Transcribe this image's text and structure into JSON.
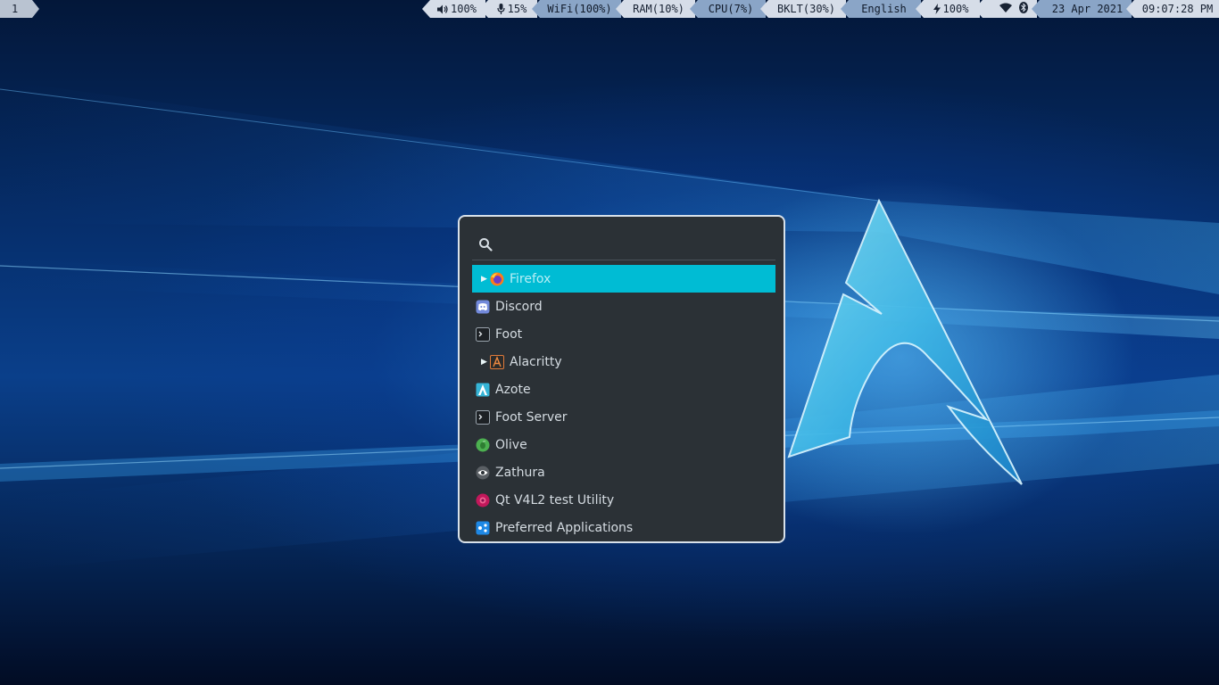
{
  "topbar": {
    "workspace": "1",
    "volume": "100%",
    "mic": "15%",
    "wifi": "WiFi(100%)",
    "ram": "RAM(10%)",
    "cpu": "CPU(7%)",
    "backlight": "BKLT(30%)",
    "language": "English",
    "battery": "100%",
    "date": "23 Apr 2021",
    "time": "09:07:28 PM",
    "icons": [
      "volume-icon",
      "microphone-icon",
      "battery-charging-icon",
      "wifi-icon",
      "bluetooth-icon"
    ]
  },
  "launcher": {
    "search": {
      "value": "",
      "placeholder": ""
    },
    "apps": [
      {
        "label": "Firefox",
        "icon": "firefox-icon",
        "selected": true,
        "expandable": true
      },
      {
        "label": "Discord",
        "icon": "discord-icon",
        "selected": false,
        "expandable": false
      },
      {
        "label": "Foot",
        "icon": "terminal-icon",
        "selected": false,
        "expandable": false
      },
      {
        "label": "Alacritty",
        "icon": "alacritty-icon",
        "selected": false,
        "expandable": true
      },
      {
        "label": "Azote",
        "icon": "azote-icon",
        "selected": false,
        "expandable": false
      },
      {
        "label": "Foot Server",
        "icon": "terminal-icon",
        "selected": false,
        "expandable": false
      },
      {
        "label": "Olive",
        "icon": "olive-icon",
        "selected": false,
        "expandable": false
      },
      {
        "label": "Zathura",
        "icon": "zathura-icon",
        "selected": false,
        "expandable": false
      },
      {
        "label": "Qt V4L2 test Utility",
        "icon": "camera-icon",
        "selected": false,
        "expandable": false
      },
      {
        "label": "Preferred Applications",
        "icon": "preferences-icon",
        "selected": false,
        "expandable": false
      }
    ]
  },
  "colors": {
    "selection": "#00bcd4",
    "launcher_bg": "#2b3136",
    "launcher_border": "#d8e1ea",
    "bar_light": "#d6dde8",
    "bar_blue": "#8aa5c7"
  }
}
